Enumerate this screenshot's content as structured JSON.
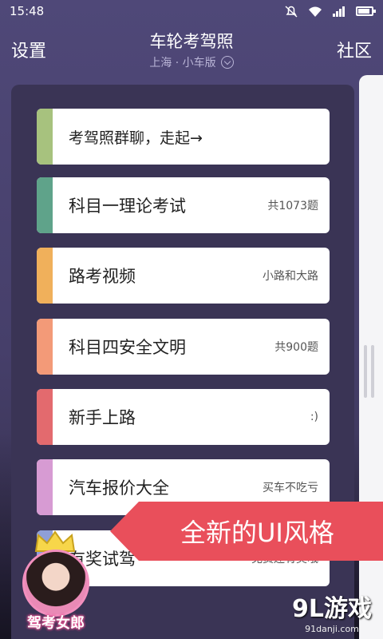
{
  "status_bar": {
    "time": "15:48"
  },
  "header": {
    "left_button": "设置",
    "title": "车轮考驾照",
    "subtitle": "上海 · 小车版",
    "right_button": "社区"
  },
  "menu": [
    {
      "label": "考驾照群聊，走起→",
      "meta": "",
      "color": "#a7c27e"
    },
    {
      "label": "科目一理论考试",
      "meta": "共1073题",
      "color": "#5fa38a"
    },
    {
      "label": "路考视频",
      "meta": "小路和大路",
      "color": "#f0b05b"
    },
    {
      "label": "科目四安全文明",
      "meta": "共900题",
      "color": "#f39a78"
    },
    {
      "label": "新手上路",
      "meta": ":)",
      "color": "#e36a6e"
    },
    {
      "label": "汽车报价大全",
      "meta": "买车不吃亏",
      "color": "#d79bd3"
    },
    {
      "label": "有奖试驾",
      "meta": "免费还有奖哦",
      "color": "#8f9fd8"
    }
  ],
  "promo": {
    "text": "全新的UI风格"
  },
  "avatar": {
    "caption": "驾考女郎"
  },
  "watermark": {
    "logo": "9L游戏",
    "url": "91danji.com"
  }
}
